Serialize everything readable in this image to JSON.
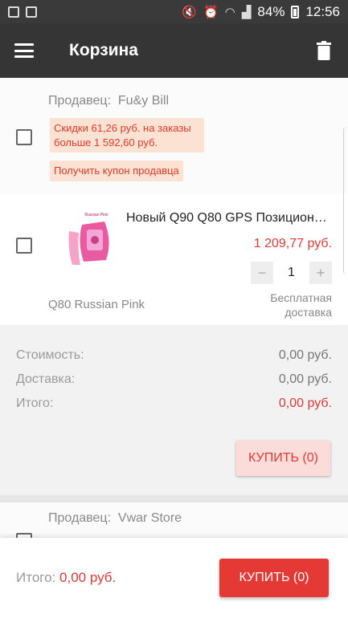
{
  "status_bar": {
    "battery": "84%",
    "time": "12:56"
  },
  "app_bar": {
    "title": "Корзина"
  },
  "cart": {
    "seller1": {
      "label": "Продавец:",
      "name": "Fu&y Bill",
      "discount_text": "Скидки 61,26 руб. на заказы\n больше 1 592,60 руб.",
      "coupon_label": "Получить купон продавца"
    },
    "product": {
      "title": "Новый Q90 Q80 GPS Позицион…",
      "image_tag": "Russian Pink",
      "price": "1 209,77 руб.",
      "quantity": "1",
      "minus": "−",
      "plus": "+",
      "variant": "Q80 Russian Pink",
      "shipping": "Бесплатная доставка"
    },
    "summary": {
      "cost_label": "Стоимость:",
      "cost_value": "0,00 руб.",
      "shipping_label": "Доставка:",
      "shipping_value": "0,00 руб.",
      "total_label": "Итого:",
      "total_value": "0,00 руб.",
      "buy_label": "КУПИТЬ (0)"
    },
    "seller2": {
      "label": "Продавец:",
      "name": "Vwar Store"
    }
  },
  "bottom_bar": {
    "total_label": "Итого:",
    "total_value": "0,00 руб.",
    "buy_label": "КУПИТЬ (0)"
  },
  "colors": {
    "accent": "#e53935",
    "app_bar": "#353535",
    "promo_bg": "#fbe2d3"
  }
}
